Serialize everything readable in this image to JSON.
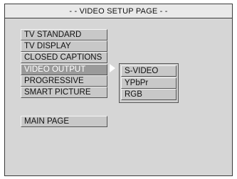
{
  "title": "- - VIDEO SETUP PAGE - -",
  "menu": {
    "items": [
      {
        "label": "TV STANDARD"
      },
      {
        "label": "TV DISPLAY"
      },
      {
        "label": "CLOSED CAPTIONS"
      },
      {
        "label": "VIDEO OUTPUT",
        "selected": true
      },
      {
        "label": "PROGRESSIVE"
      },
      {
        "label": "SMART PICTURE"
      }
    ],
    "main_page": "MAIN PAGE"
  },
  "submenu": {
    "options": [
      {
        "label": "S-VIDEO"
      },
      {
        "label": "YPbPr"
      },
      {
        "label": "RGB"
      }
    ]
  },
  "icons": {
    "selection_arrow": "triangle-right-icon"
  },
  "colors": {
    "panel_bg": "#d6d6d6",
    "item_bg": "#c8c8c8",
    "selected_bg": "#9a9a9a",
    "selected_text": "#ffffff"
  }
}
